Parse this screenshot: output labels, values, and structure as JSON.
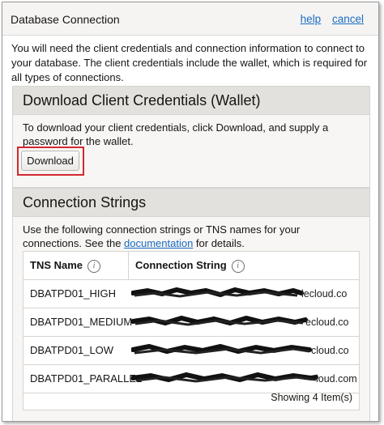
{
  "dialog": {
    "title": "Database Connection",
    "help_label": "help",
    "cancel_label": "cancel",
    "intro": "You will need the client credentials and connection information to connect to your database. The client credentials include the wallet, which is required for all types of connections."
  },
  "credentials_panel": {
    "heading": "Download Client Credentials (Wallet)",
    "text": "To download your client credentials, click Download, and supply a password for the wallet.",
    "download_label": "Download"
  },
  "connections_panel": {
    "heading": "Connection Strings",
    "text_before": "Use the following connection strings or TNS names for your connections. See the ",
    "link_text": "documentation",
    "text_after": " for details.",
    "columns": [
      "TNS Name",
      "Connection String"
    ],
    "rows": [
      {
        "tns": "DBATPD01_HIGH",
        "visible_suffix": "lecloud.co"
      },
      {
        "tns": "DBATPD01_MEDIUM",
        "visible_suffix": "ecloud.co"
      },
      {
        "tns": "DBATPD01_LOW",
        "visible_suffix": "cloud.co"
      },
      {
        "tns": "DBATPD01_PARALLEL",
        "visible_suffix": "loud.com"
      }
    ],
    "footer": "Showing 4 Item(s)"
  },
  "colors": {
    "link": "#1a6dc4",
    "highlight_border": "#d4282f",
    "panel_header_bg": "#e3e1dd"
  },
  "icons": {
    "info": "info-circle-icon"
  }
}
